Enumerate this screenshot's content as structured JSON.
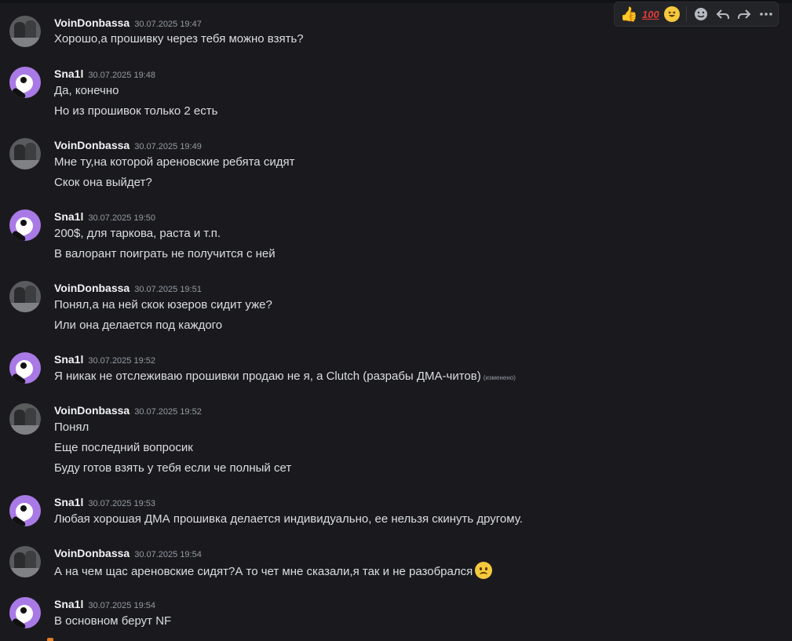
{
  "toolbar": {
    "reactions": [
      "thumbs-up",
      "hundred-points",
      "squinting-grin"
    ],
    "hundred_text": "100",
    "actions": [
      "add-reaction",
      "reply",
      "forward",
      "more"
    ]
  },
  "users": {
    "voin": "VoinDonbassa",
    "snail": "Sna1l"
  },
  "messages": [
    {
      "user": "VoinDonbassa",
      "time": "30.07.2025 19:47",
      "lines": [
        "Хорошо,а прошивку через тебя можно взять?"
      ]
    },
    {
      "user": "Sna1l",
      "time": "30.07.2025 19:48",
      "lines": [
        "Да, конечно",
        "Но из прошивок только 2 есть"
      ]
    },
    {
      "user": "VoinDonbassa",
      "time": "30.07.2025 19:49",
      "lines": [
        "Мне ту,на которой ареновские ребята сидят",
        "Скок она выйдет?"
      ]
    },
    {
      "user": "Sna1l",
      "time": "30.07.2025 19:50",
      "lines": [
        "200$, для таркова, раста и т.п.",
        "В валорант поиграть не получится с ней"
      ]
    },
    {
      "user": "VoinDonbassa",
      "time": "30.07.2025 19:51",
      "lines": [
        "Понял,а на ней скок юзеров сидит уже?",
        "Или она делается под каждого"
      ]
    },
    {
      "user": "Sna1l",
      "time": "30.07.2025 19:52",
      "lines": [
        "Я никак не отслеживаю прошивки продаю не я, а Clutch (разрабы ДМА-читов)"
      ],
      "edited": "(изменено)"
    },
    {
      "user": "VoinDonbassa",
      "time": "30.07.2025 19:52",
      "lines": [
        "Понял",
        "Еще последний вопросик",
        "Буду готов взять у тебя если че полный сет"
      ]
    },
    {
      "user": "Sna1l",
      "time": "30.07.2025 19:53",
      "lines": [
        "Любая хорошая ДМА прошивка делается индивидуально, ее нельзя скинуть другому."
      ]
    },
    {
      "user": "VoinDonbassa",
      "time": "30.07.2025 19:54",
      "lines": [
        "А на чем щас ареновские сидят?А то чет мне сказали,я так и не разобрался"
      ],
      "emoji": "slightly-frowning-face"
    },
    {
      "user": "Sna1l",
      "time": "30.07.2025 19:54",
      "lines": [
        "В основном берут NF"
      ]
    }
  ]
}
